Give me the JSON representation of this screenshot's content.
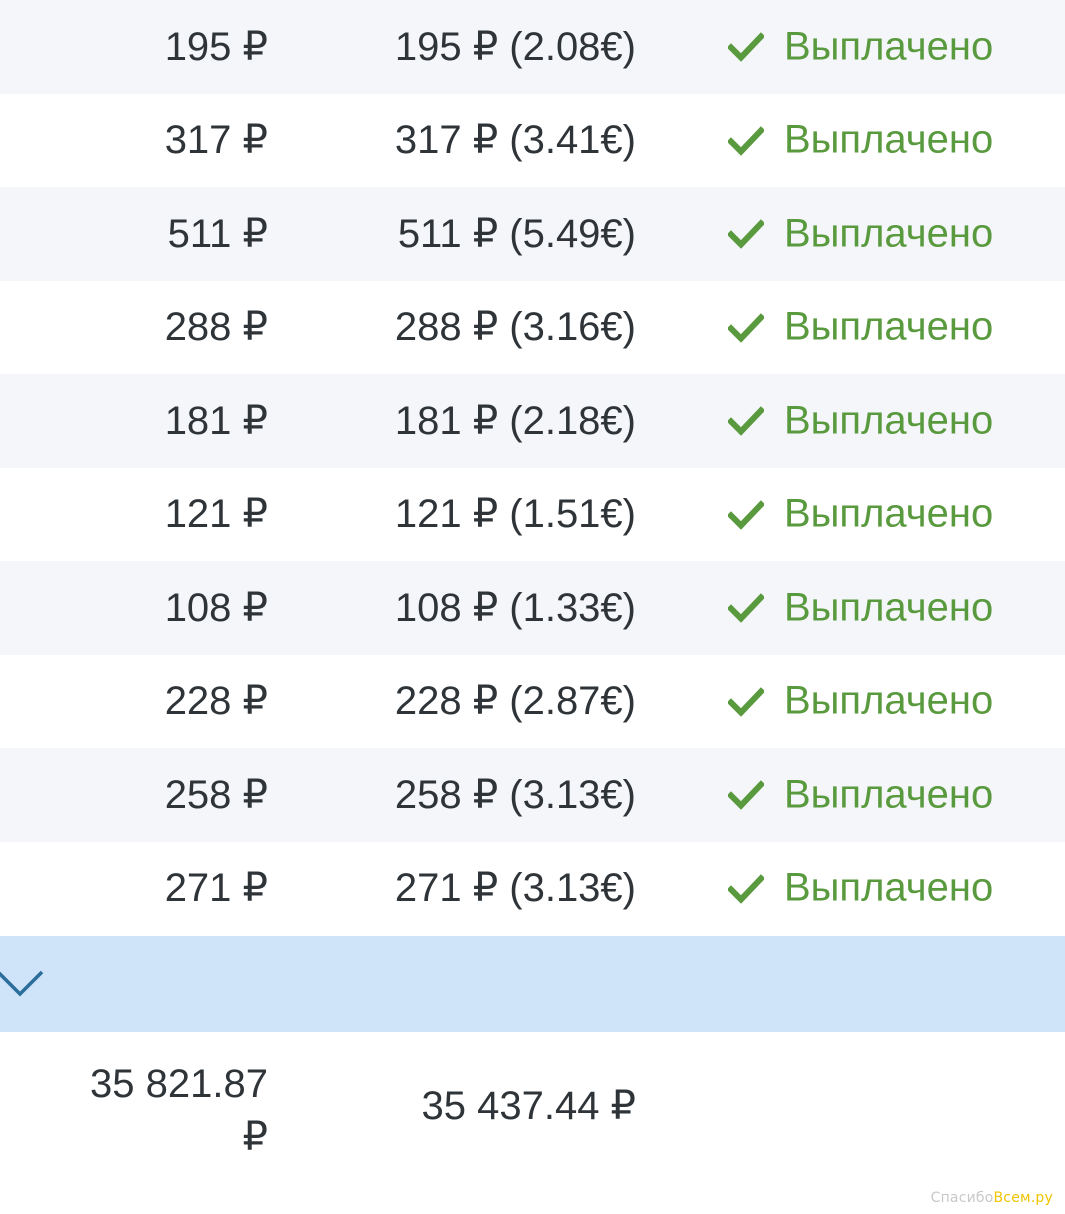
{
  "rows": [
    {
      "amount": "195 ₽",
      "paid": "195 ₽ (2.08€)",
      "status": "Выплачено"
    },
    {
      "amount": "317 ₽",
      "paid": "317 ₽ (3.41€)",
      "status": "Выплачено"
    },
    {
      "amount": "511 ₽",
      "paid": "511 ₽ (5.49€)",
      "status": "Выплачено"
    },
    {
      "amount": "288 ₽",
      "paid": "288 ₽ (3.16€)",
      "status": "Выплачено"
    },
    {
      "amount": "181 ₽",
      "paid": "181 ₽ (2.18€)",
      "status": "Выплачено"
    },
    {
      "amount": "121 ₽",
      "paid": "121 ₽ (1.51€)",
      "status": "Выплачено"
    },
    {
      "amount": "108 ₽",
      "paid": "108 ₽ (1.33€)",
      "status": "Выплачено"
    },
    {
      "amount": "228 ₽",
      "paid": "228 ₽ (2.87€)",
      "status": "Выплачено"
    },
    {
      "amount": "258 ₽",
      "paid": "258 ₽ (3.13€)",
      "status": "Выплачено"
    },
    {
      "amount": "271 ₽",
      "paid": "271 ₽ (3.13€)",
      "status": "Выплачено"
    }
  ],
  "totals": {
    "amount": "35 821.87 ₽",
    "paid": "35 437.44 ₽"
  },
  "icons": {
    "status": "check-icon",
    "expand": "chevron-down-icon"
  },
  "colors": {
    "status_green": "#5a9a3e",
    "row_alt": "#f4f6f9",
    "expand_bar": "#cfe3f9",
    "chevron": "#2a6f9b",
    "text": "#2f3439"
  },
  "watermark": {
    "part1": "Спасибо",
    "part2": "Всем.ру"
  }
}
